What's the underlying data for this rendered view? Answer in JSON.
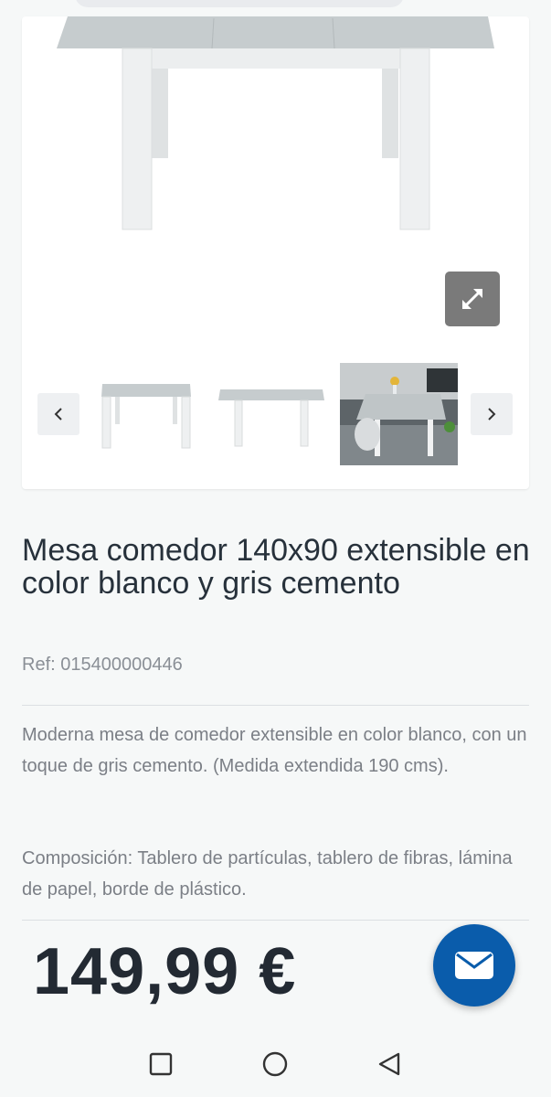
{
  "product": {
    "title": "Mesa comedor 140x90 extensible en color blanco y gris cemento",
    "ref": "Ref: 015400000446",
    "description": "Moderna mesa de comedor extensible en color blanco, con un toque de gris cemento. (Medida extendida 190 cms).",
    "composition": "Composición: Tablero de partículas, tablero de fibras, lámina de papel, borde de plástico.",
    "price": "149,99 €"
  },
  "gallery": {
    "zoom_icon": "expand-icon",
    "prev_icon": "chevron-left-icon",
    "next_icon": "chevron-right-icon"
  },
  "contact": {
    "icon": "envelope-icon"
  },
  "system_nav": {
    "icons": [
      "square-icon",
      "circle-icon",
      "triangle-back-icon"
    ]
  },
  "colors": {
    "price": "#232a33",
    "fab": "#0a5cab",
    "tabletop": "#c9cfd1",
    "legs": "#f4f5f6"
  }
}
